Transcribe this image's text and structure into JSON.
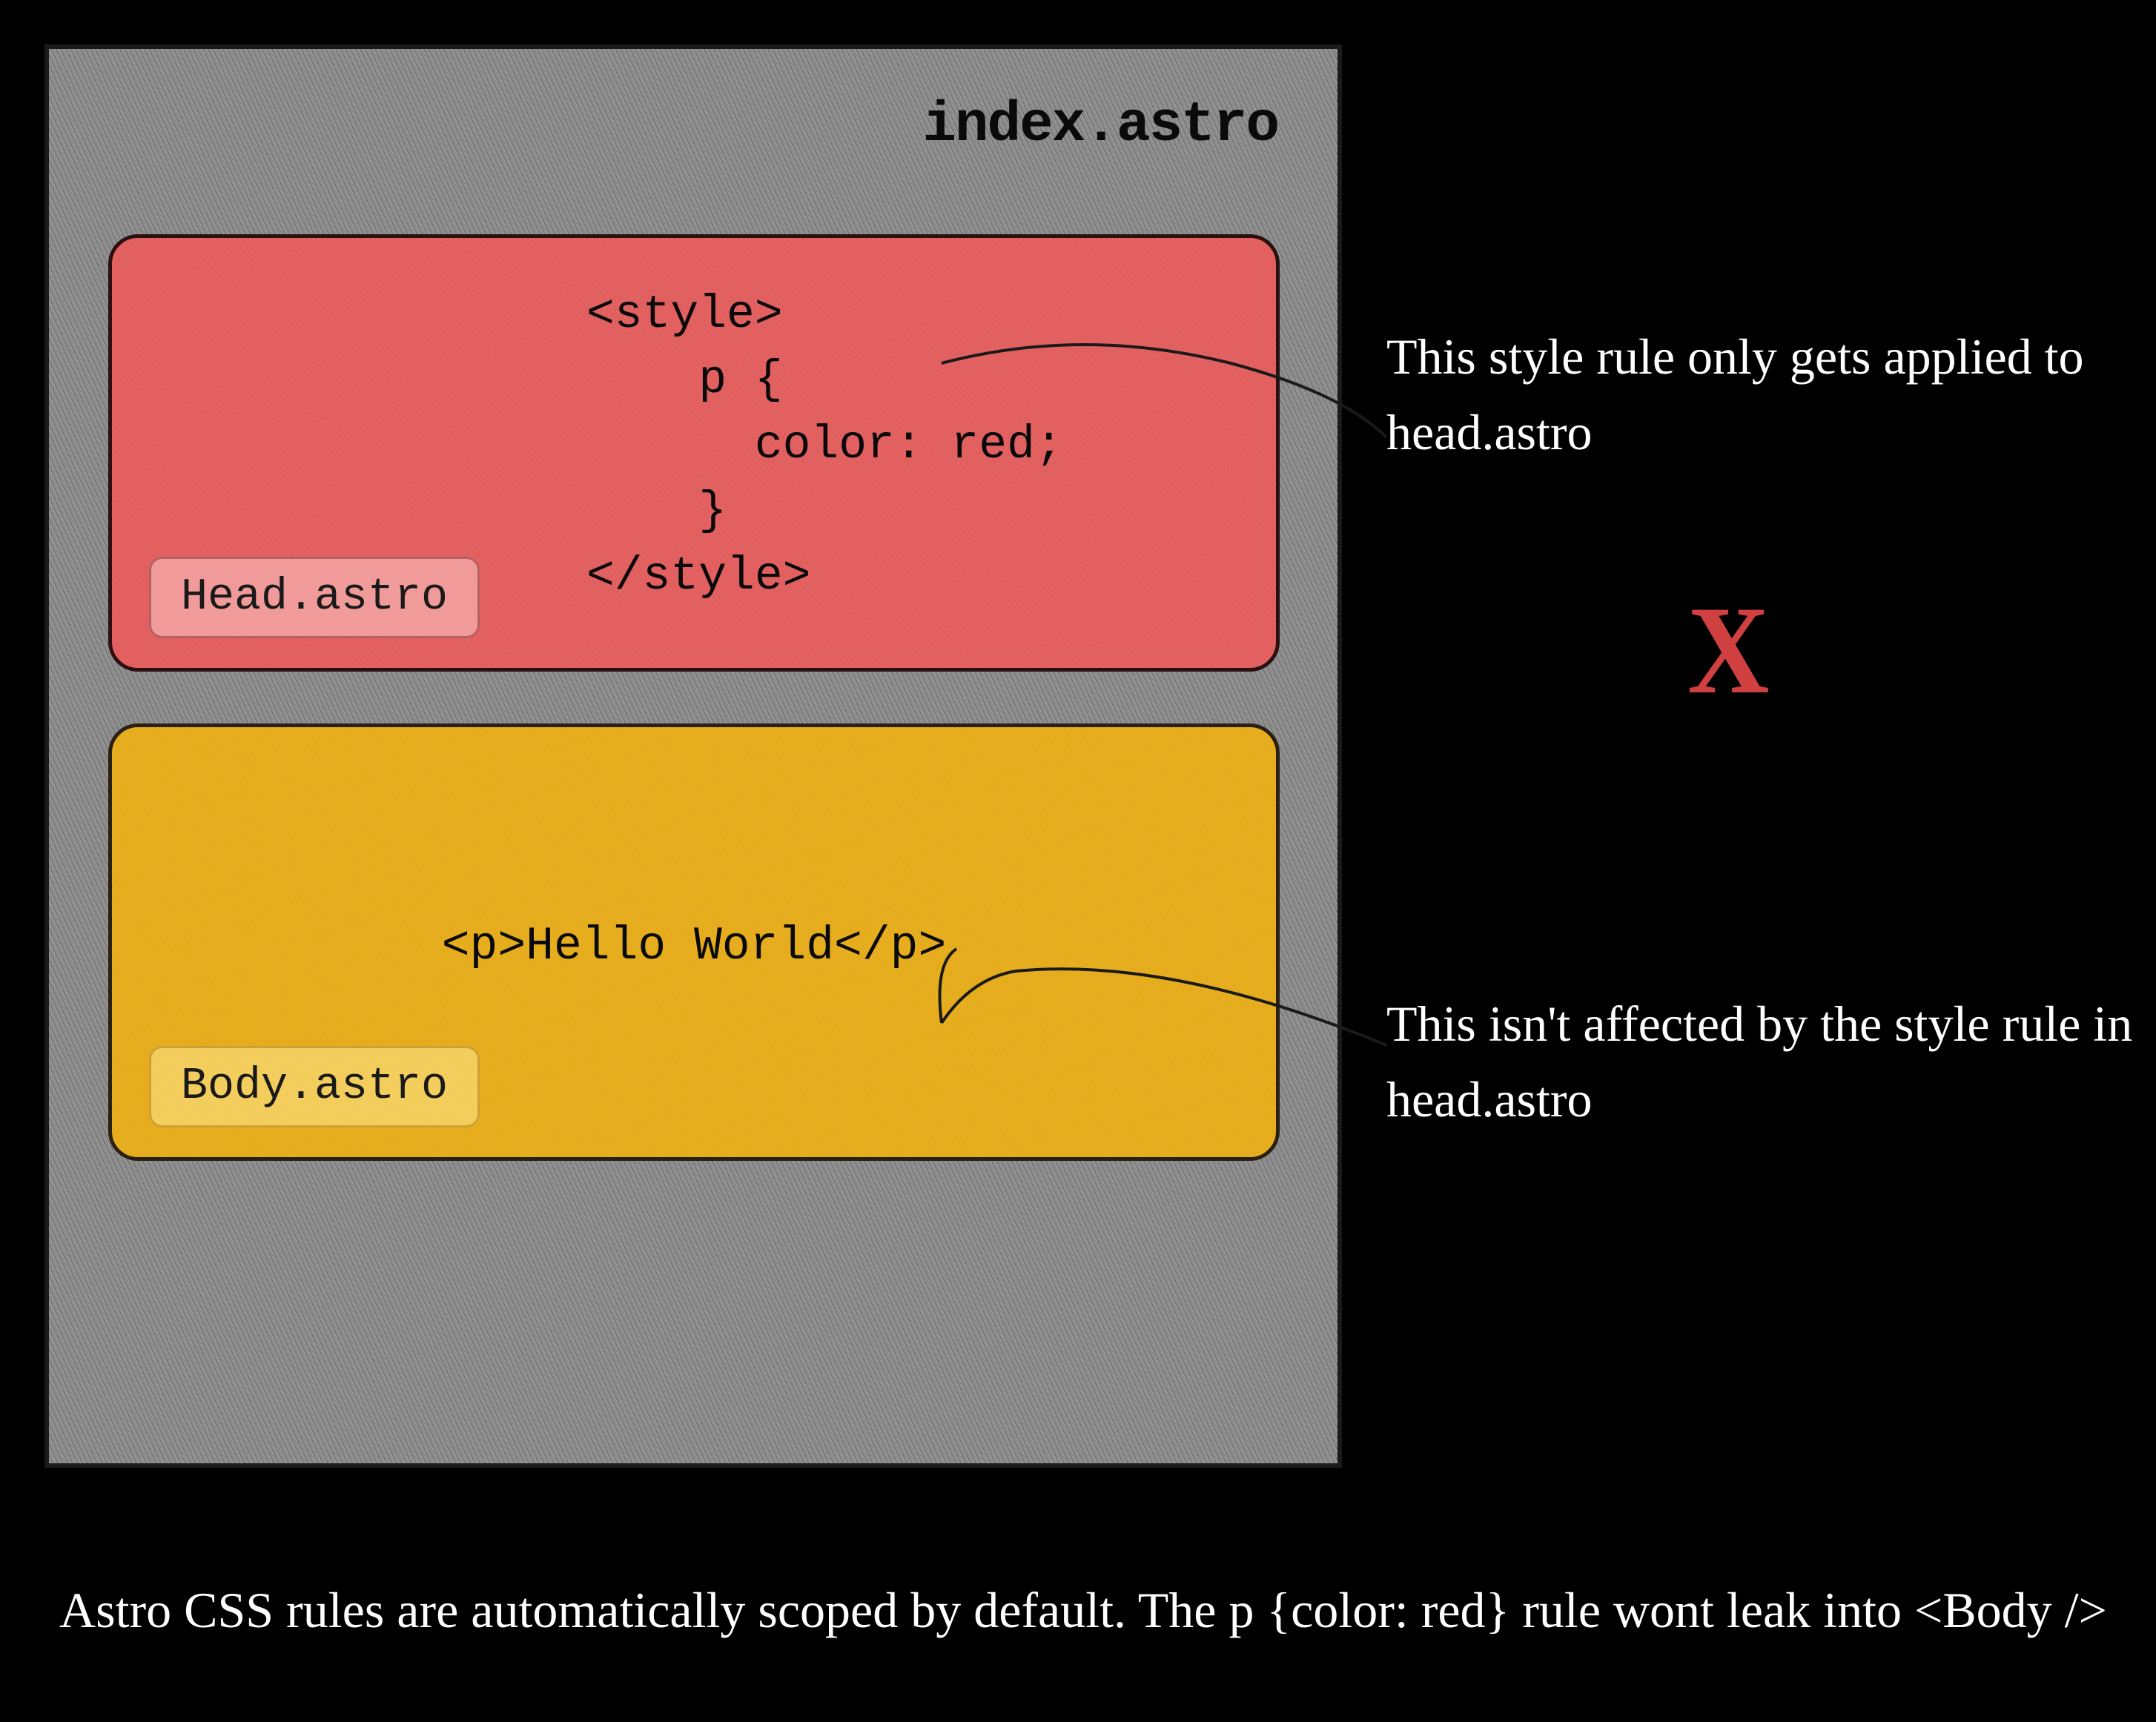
{
  "container": {
    "title": "index.astro"
  },
  "head": {
    "label": "Head.astro",
    "code": "<style>\n    p {\n      color: red;\n    }\n</style>"
  },
  "body": {
    "label": "Body.astro",
    "code": "<p>Hello World</p>"
  },
  "annotations": {
    "top": "This style rule only\ngets applied to head.astro",
    "x_mark": "X",
    "bottom": "This isn't affected\nby the style rule\nin head.astro",
    "footer": "Astro CSS rules are automatically scoped by default.\nThe p {color: red} rule wont leak into <Body />"
  }
}
